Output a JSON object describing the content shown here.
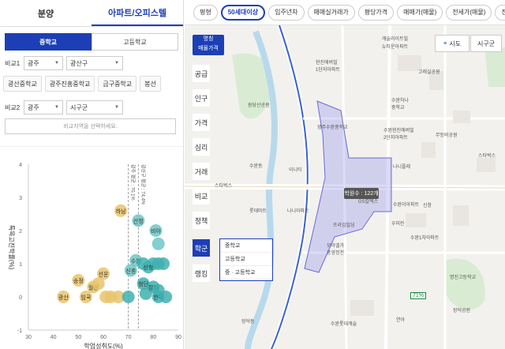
{
  "tabs": [
    "분양",
    "아파트/오피스텔"
  ],
  "seg": [
    "중학교",
    "고등학교"
  ],
  "compare1": {
    "label": "비교1",
    "sel1": "광주",
    "sel2": "광산구"
  },
  "chips": [
    "광산중학교",
    "광주진흥중학교",
    "금구중학교",
    "봉선"
  ],
  "compare2": {
    "label": "비교2",
    "sel1": "광주",
    "sel2": "시구군"
  },
  "hint": "비교지역을 선택하세요.",
  "chart_data": {
    "type": "scatter",
    "xlabel": "학업성취도(%)",
    "ylabel": "특목고진학률(%)",
    "xlim": [
      30,
      90
    ],
    "ylim": [
      -1,
      4
    ],
    "xticks": [
      30,
      40,
      50,
      60,
      70,
      80,
      90
    ],
    "yticks": [
      -1,
      0,
      1,
      2,
      3,
      4
    ],
    "vlines": [
      {
        "x": 70,
        "label": "광주 평균 : 70.1%"
      },
      {
        "x": 74,
        "label": "광산구 평균 : 74.4%"
      }
    ],
    "points": [
      {
        "label": "하남",
        "x": 67,
        "y": 2.6,
        "color": "#e9c46a"
      },
      {
        "label": "산정",
        "x": 74,
        "y": 2.3,
        "color": "#6fc7c7"
      },
      {
        "label": "비아",
        "x": 81,
        "y": 2.0,
        "color": "#6fc7c7"
      },
      {
        "label": "",
        "x": 82,
        "y": 1.6,
        "color": "#6fc7c7"
      },
      {
        "label": "수완",
        "x": 73,
        "y": 1.1,
        "color": "#6fc7c7"
      },
      {
        "label": "",
        "x": 76,
        "y": 1.0,
        "color": "#3fb0b0"
      },
      {
        "label": "",
        "x": 80,
        "y": 1.0,
        "color": "#3fb0b0"
      },
      {
        "label": "신창",
        "x": 78,
        "y": 0.9,
        "color": "#3fb0b0"
      },
      {
        "label": "",
        "x": 82,
        "y": 1.0,
        "color": "#3fb0b0"
      },
      {
        "label": "",
        "x": 84,
        "y": 1.0,
        "color": "#3fb0b0"
      },
      {
        "label": "신흥",
        "x": 71,
        "y": 0.8,
        "color": "#6fc7c7"
      },
      {
        "label": "선운",
        "x": 60,
        "y": 0.7,
        "color": "#e9c46a"
      },
      {
        "label": "송정",
        "x": 50,
        "y": 0.5,
        "color": "#e9c46a"
      },
      {
        "label": "월봉",
        "x": 56,
        "y": 0.3,
        "color": "#e9c46a"
      },
      {
        "label": "",
        "x": 58,
        "y": 0.4,
        "color": "#e9c46a"
      },
      {
        "label": "첨단",
        "x": 76,
        "y": 0.4,
        "color": "#3fb0b0"
      },
      {
        "label": "",
        "x": 77,
        "y": 0.1,
        "color": "#3fb0b0"
      },
      {
        "label": "장덕",
        "x": 80,
        "y": 0.3,
        "color": "#3fb0b0"
      },
      {
        "label": "",
        "x": 82,
        "y": 0.2,
        "color": "#3fb0b0"
      },
      {
        "label": "광산",
        "x": 44,
        "y": 0.0,
        "color": "#e9c46a"
      },
      {
        "label": "임곡",
        "x": 53,
        "y": 0.0,
        "color": "#e9c46a"
      },
      {
        "label": "",
        "x": 61,
        "y": 0.0,
        "color": "#e9c46a"
      },
      {
        "label": "",
        "x": 63,
        "y": 0.0,
        "color": "#e9c46a"
      },
      {
        "label": "",
        "x": 66,
        "y": 0.0,
        "color": "#e9c46a"
      },
      {
        "label": "",
        "x": 70,
        "y": 0.0,
        "color": "#3fb0b0"
      },
      {
        "label": "한국",
        "x": 82,
        "y": 0.0,
        "color": "#3fb0b0"
      },
      {
        "label": "",
        "x": 85,
        "y": 0.0,
        "color": "#3fb0b0"
      }
    ]
  },
  "filters": [
    "평형",
    "50세대이상",
    "입주년차",
    "매매실거래가",
    "평당가격",
    "매매가(매물)",
    "전세가(매물)",
    "전세"
  ],
  "badge": {
    "line1": "명칭",
    "line2": "매물가격"
  },
  "side": [
    "공급",
    "인구",
    "가격",
    "심리",
    "거래",
    "비교",
    "정책",
    "학군",
    "랭킹"
  ],
  "popup": [
    "중학교",
    "고등학교",
    "중 · 고등학교"
  ],
  "mapbtns": {
    "locate": "시도",
    "region": "시구군"
  },
  "callout": "학원수 : 122개",
  "flag": "71%",
  "mapLabels": [
    "캐슬라이트빌",
    "뉴타운아파트",
    "현진에버빌",
    "1단지아파트",
    "고래실공원",
    "수완하나",
    "중학교",
    "원당산공원",
    "광주수완중학교",
    "수완현진에버빌",
    "2단지아파트",
    "무등비공원",
    "수완동",
    "이니티",
    "나니플레",
    "스타벅스",
    "롯데마트",
    "나니아파트",
    "GS칼텍스",
    "수완이아파트",
    "우미린",
    "모아엘가",
    "풍영정천",
    "신창",
    "프라임빌딩",
    "수완1차아파트",
    "명진고등학교",
    "연아",
    "스타벅스",
    "수완롯데캐슬",
    "장덕공원",
    "장덕동"
  ]
}
